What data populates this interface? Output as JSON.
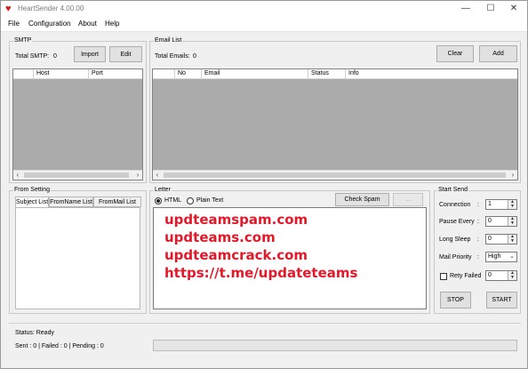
{
  "window": {
    "title": "HeartSender 4.00.00",
    "icon": "heart-icon",
    "controls": {
      "minimize": "—",
      "maximize": "☐",
      "close": "✕"
    }
  },
  "menu": [
    "File",
    "Configuration",
    "About",
    "Help"
  ],
  "smtp": {
    "group_label": "SMTP",
    "total_label": "Total SMTP:",
    "total_value": "0",
    "import_label": "Import",
    "edit_label": "Edit",
    "columns": [
      "Host",
      "Port"
    ]
  },
  "email_list": {
    "group_label": "Email List",
    "total_label": "Total Emails:",
    "total_value": "0",
    "clear_label": "Clear",
    "add_label": "Add",
    "columns": [
      "No",
      "Email",
      "Status",
      "Info"
    ]
  },
  "from_setting": {
    "group_label": "From Setting",
    "tabs": [
      "Subject List",
      "FromName List",
      "FromMail List"
    ],
    "active_tab": "Subject List"
  },
  "letter": {
    "group_label": "Letter",
    "html_label": "HTML",
    "plain_label": "Plain Text",
    "selected_format": "HTML",
    "check_spam_label": "Check Spam",
    "dots_label": "...",
    "body_lines": [
      "updteamspam.com",
      "updteams.com",
      "updteamcrack.com",
      "https://t.me/updateteams"
    ],
    "body_color": "#e3192a"
  },
  "start_send": {
    "group_label": "Start Send",
    "connection_label": "Connection",
    "connection_value": "1",
    "pause_label": "Pause Every",
    "pause_value": "0",
    "sleep_label": "Long Sleep",
    "sleep_value": "0",
    "priority_label": "Mail Priority",
    "priority_value": "High",
    "retry_label": "Rety Failed",
    "retry_value": "0",
    "colon": ":",
    "stop_label": "STOP",
    "start_label": "START"
  },
  "status": {
    "status_text": "Status: Ready",
    "counts_text": "Sent : 0 | Failed : 0 | Pending : 0",
    "progress": 0
  }
}
